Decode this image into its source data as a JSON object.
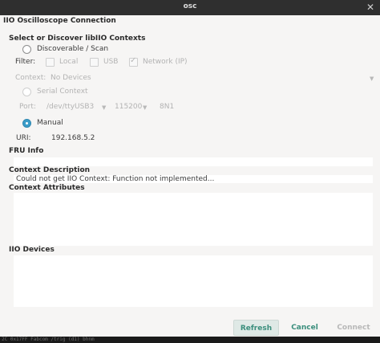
{
  "window": {
    "title": "osc"
  },
  "dialog_title": "IIO Oscilloscope Connection",
  "discover_section": {
    "title": "Select or Discover libIIO Contexts",
    "discoverable_label": "Discoverable / Scan",
    "filter_label": "Filter:",
    "filters": [
      {
        "label": "Local",
        "checked": false
      },
      {
        "label": "USB",
        "checked": false
      },
      {
        "label": "Network (IP)",
        "checked": true
      }
    ],
    "context_label": "Context:",
    "context_value": "No Devices",
    "serial_label": "Serial Context",
    "port_label": "Port:",
    "port_value": "/dev/ttyUSB3",
    "baud_value": "115200",
    "format_value": "8N1",
    "manual_label": "Manual",
    "uri_label": "URI:",
    "uri_value": "192.168.5.2"
  },
  "fru_info": {
    "title": "FRU Info"
  },
  "context_description": {
    "title": "Context Description",
    "text": "Could not get IIO Context: Function not implemented..."
  },
  "context_attributes": {
    "title": "Context Attributes"
  },
  "iio_devices": {
    "title": "IIO Devices"
  },
  "buttons": {
    "refresh": "Refresh",
    "cancel": "Cancel",
    "connect": "Connect"
  },
  "terminal_text": "2C 0x17FF Fabcom  /trig (d1) bhnm"
}
